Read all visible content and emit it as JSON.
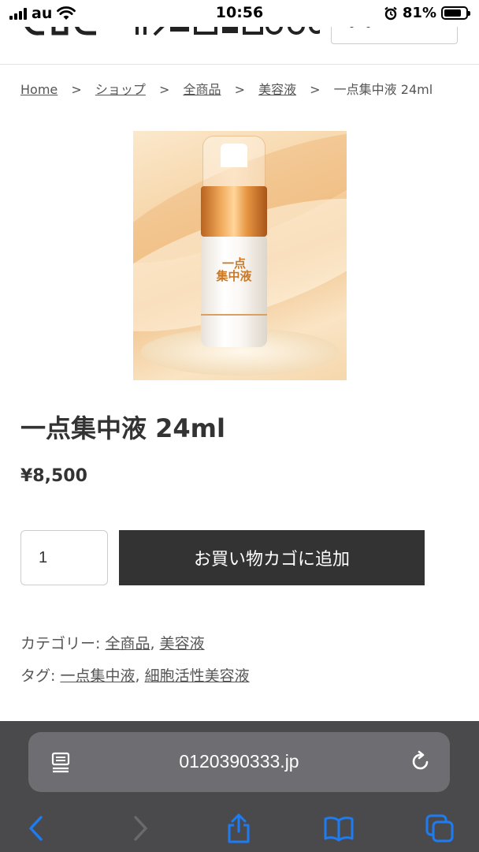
{
  "status_bar": {
    "carrier": "au",
    "time": "10:56",
    "battery": "81%",
    "battery_level": 0.81
  },
  "breadcrumb": {
    "home": "Home",
    "sep": ">",
    "items": [
      "ショップ",
      "全商品",
      "美容液"
    ],
    "current": "一点集中液 24ml"
  },
  "product": {
    "label_line1": "一点",
    "label_line2": "集中液",
    "title": "一点集中液 24ml",
    "price": "¥8,500",
    "quantity": "1",
    "add_to_cart": "お買い物カゴに追加"
  },
  "meta": {
    "category_label": "カテゴリー:",
    "categories": [
      "全商品",
      "美容液"
    ],
    "tag_label": "タグ:",
    "tags": [
      "一点集中液",
      "細胞活性美容液"
    ],
    "comma": ","
  },
  "browser": {
    "url": "0120390333.jp"
  },
  "icons": {
    "reader": "reader-icon",
    "reload": "reload-icon",
    "back": "back-icon",
    "forward": "forward-icon",
    "share": "share-icon",
    "bookmarks": "bookmarks-icon",
    "tabs": "tabs-icon"
  },
  "colors": {
    "button_bg": "#333333",
    "safari_bar": "#4a4a4c",
    "ios_blue": "#1e7cf2"
  }
}
